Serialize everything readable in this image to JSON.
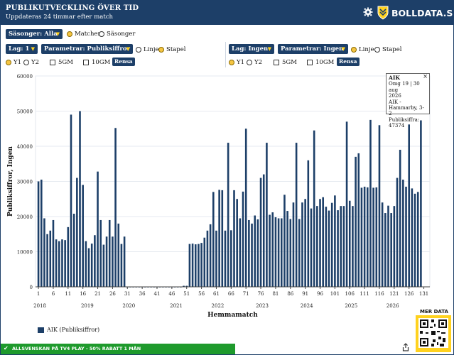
{
  "header": {
    "title": "PUBLIKUTVECKLING ÖVER TID",
    "subtitle": "Uppdateras 24 timmar efter match",
    "brand": "BOLLDATA.SE"
  },
  "controls": {
    "season_select": "Säsonger: Alla",
    "mode_matches": "Matcher",
    "mode_seasons": "Säsonger",
    "left": {
      "team_select": "Lag: 1",
      "param_select": "Parametrar: Publiksiffror",
      "line": "Linje",
      "bar": "Stapel",
      "y1": "Y1",
      "y2": "Y2",
      "sgm": "5GM",
      "tgm": "10GM",
      "clear": "Rensa"
    },
    "right": {
      "team_select": "Lag: Ingen",
      "param_select": "Parametrar: Ingen",
      "line": "Linje",
      "bar": "Stapel",
      "y1": "Y1",
      "y2": "Y2",
      "sgm": "5GM",
      "tgm": "10GM",
      "clear": "Rensa"
    }
  },
  "tooltip": {
    "title": "AIK",
    "line1": "Omg 19 | 30 aug",
    "line2": "2026",
    "line3": "AIK -",
    "line4": "Hammarby, 3-2",
    "line5": "Publiksiffra:",
    "line6": "47374"
  },
  "legend_label": "AIK (Publiksiffror)",
  "footer_text": "ALLSVENSKAN PÅ TV4 PLAY - 50% RABATT 1 MÅN",
  "more_data": "MER DATA",
  "colors": {
    "navy": "#1d3f68",
    "accent": "#ffd21f",
    "green": "#1e9a2c"
  },
  "chart_data": {
    "type": "bar",
    "xlabel": "Hemmamatch",
    "ylabel": "Publiksiffror, Ingen",
    "ylim": [
      0,
      60000
    ],
    "yticks": [
      "0",
      "10000",
      "20000",
      "30000",
      "40000",
      "50000",
      "60000"
    ],
    "xticks": [
      "1",
      "6",
      "11",
      "16",
      "21",
      "26",
      "31",
      "36",
      "41",
      "46",
      "51",
      "56",
      "61",
      "66",
      "71",
      "76",
      "81",
      "86",
      "91",
      "96",
      "101",
      "106",
      "111",
      "116",
      "121",
      "126",
      "131"
    ],
    "years": [
      "2018",
      "2019",
      "2020",
      "2021",
      "2022",
      "2023",
      "2024",
      "2025",
      "2026"
    ],
    "series": [
      {
        "name": "AIK (Publiksiffror)",
        "values": [
          30000,
          30500,
          19500,
          15000,
          16000,
          19000,
          13500,
          13000,
          13500,
          13300,
          17000,
          49000,
          20800,
          31000,
          50000,
          29000,
          13000,
          11000,
          12300,
          14700,
          32800,
          19000,
          12000,
          14300,
          19000,
          14300,
          45200,
          18000,
          12200,
          14300,
          0,
          0,
          0,
          0,
          0,
          0,
          0,
          0,
          0,
          0,
          0,
          0,
          0,
          0,
          0,
          0,
          0,
          0,
          0,
          300,
          300,
          12200,
          12300,
          12100,
          12200,
          12500,
          14000,
          16000,
          17800,
          27000,
          16000,
          27600,
          27500,
          16000,
          41000,
          16100,
          27500,
          25000,
          19500,
          27100,
          45000,
          19000,
          18000,
          20300,
          19200,
          31000,
          32000,
          41000,
          20500,
          21200,
          19800,
          19500,
          19500,
          26200,
          21600,
          19300,
          24000,
          41000,
          19300,
          24000,
          25000,
          36000,
          22300,
          44500,
          23000,
          25000,
          25500,
          22800,
          21700,
          23900,
          26000,
          21800,
          23000,
          23000,
          47000,
          24500,
          23000,
          37000,
          38000,
          28200,
          28500,
          28300,
          47500,
          28200,
          28300,
          46000,
          24000,
          21000,
          23100,
          21000,
          23000,
          31000,
          39000,
          30500,
          28500,
          46200,
          28000,
          26500,
          27000,
          47374
        ]
      }
    ]
  }
}
